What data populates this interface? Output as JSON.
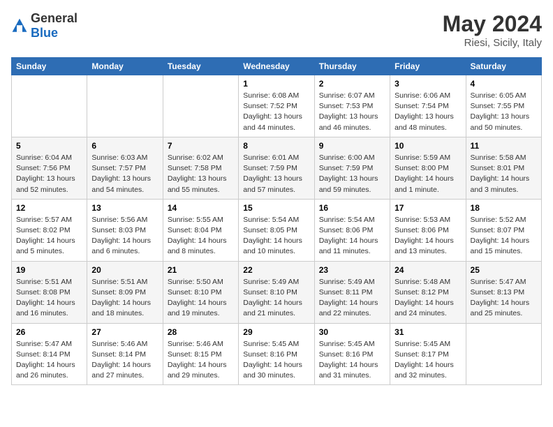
{
  "logo": {
    "text_general": "General",
    "text_blue": "Blue"
  },
  "title": {
    "month_year": "May 2024",
    "location": "Riesi, Sicily, Italy"
  },
  "weekdays": [
    "Sunday",
    "Monday",
    "Tuesday",
    "Wednesday",
    "Thursday",
    "Friday",
    "Saturday"
  ],
  "weeks": [
    [
      {
        "day": "",
        "sunrise": "",
        "sunset": "",
        "daylight": ""
      },
      {
        "day": "",
        "sunrise": "",
        "sunset": "",
        "daylight": ""
      },
      {
        "day": "",
        "sunrise": "",
        "sunset": "",
        "daylight": ""
      },
      {
        "day": "1",
        "sunrise": "Sunrise: 6:08 AM",
        "sunset": "Sunset: 7:52 PM",
        "daylight": "Daylight: 13 hours and 44 minutes."
      },
      {
        "day": "2",
        "sunrise": "Sunrise: 6:07 AM",
        "sunset": "Sunset: 7:53 PM",
        "daylight": "Daylight: 13 hours and 46 minutes."
      },
      {
        "day": "3",
        "sunrise": "Sunrise: 6:06 AM",
        "sunset": "Sunset: 7:54 PM",
        "daylight": "Daylight: 13 hours and 48 minutes."
      },
      {
        "day": "4",
        "sunrise": "Sunrise: 6:05 AM",
        "sunset": "Sunset: 7:55 PM",
        "daylight": "Daylight: 13 hours and 50 minutes."
      }
    ],
    [
      {
        "day": "5",
        "sunrise": "Sunrise: 6:04 AM",
        "sunset": "Sunset: 7:56 PM",
        "daylight": "Daylight: 13 hours and 52 minutes."
      },
      {
        "day": "6",
        "sunrise": "Sunrise: 6:03 AM",
        "sunset": "Sunset: 7:57 PM",
        "daylight": "Daylight: 13 hours and 54 minutes."
      },
      {
        "day": "7",
        "sunrise": "Sunrise: 6:02 AM",
        "sunset": "Sunset: 7:58 PM",
        "daylight": "Daylight: 13 hours and 55 minutes."
      },
      {
        "day": "8",
        "sunrise": "Sunrise: 6:01 AM",
        "sunset": "Sunset: 7:59 PM",
        "daylight": "Daylight: 13 hours and 57 minutes."
      },
      {
        "day": "9",
        "sunrise": "Sunrise: 6:00 AM",
        "sunset": "Sunset: 7:59 PM",
        "daylight": "Daylight: 13 hours and 59 minutes."
      },
      {
        "day": "10",
        "sunrise": "Sunrise: 5:59 AM",
        "sunset": "Sunset: 8:00 PM",
        "daylight": "Daylight: 14 hours and 1 minute."
      },
      {
        "day": "11",
        "sunrise": "Sunrise: 5:58 AM",
        "sunset": "Sunset: 8:01 PM",
        "daylight": "Daylight: 14 hours and 3 minutes."
      }
    ],
    [
      {
        "day": "12",
        "sunrise": "Sunrise: 5:57 AM",
        "sunset": "Sunset: 8:02 PM",
        "daylight": "Daylight: 14 hours and 5 minutes."
      },
      {
        "day": "13",
        "sunrise": "Sunrise: 5:56 AM",
        "sunset": "Sunset: 8:03 PM",
        "daylight": "Daylight: 14 hours and 6 minutes."
      },
      {
        "day": "14",
        "sunrise": "Sunrise: 5:55 AM",
        "sunset": "Sunset: 8:04 PM",
        "daylight": "Daylight: 14 hours and 8 minutes."
      },
      {
        "day": "15",
        "sunrise": "Sunrise: 5:54 AM",
        "sunset": "Sunset: 8:05 PM",
        "daylight": "Daylight: 14 hours and 10 minutes."
      },
      {
        "day": "16",
        "sunrise": "Sunrise: 5:54 AM",
        "sunset": "Sunset: 8:06 PM",
        "daylight": "Daylight: 14 hours and 11 minutes."
      },
      {
        "day": "17",
        "sunrise": "Sunrise: 5:53 AM",
        "sunset": "Sunset: 8:06 PM",
        "daylight": "Daylight: 14 hours and 13 minutes."
      },
      {
        "day": "18",
        "sunrise": "Sunrise: 5:52 AM",
        "sunset": "Sunset: 8:07 PM",
        "daylight": "Daylight: 14 hours and 15 minutes."
      }
    ],
    [
      {
        "day": "19",
        "sunrise": "Sunrise: 5:51 AM",
        "sunset": "Sunset: 8:08 PM",
        "daylight": "Daylight: 14 hours and 16 minutes."
      },
      {
        "day": "20",
        "sunrise": "Sunrise: 5:51 AM",
        "sunset": "Sunset: 8:09 PM",
        "daylight": "Daylight: 14 hours and 18 minutes."
      },
      {
        "day": "21",
        "sunrise": "Sunrise: 5:50 AM",
        "sunset": "Sunset: 8:10 PM",
        "daylight": "Daylight: 14 hours and 19 minutes."
      },
      {
        "day": "22",
        "sunrise": "Sunrise: 5:49 AM",
        "sunset": "Sunset: 8:10 PM",
        "daylight": "Daylight: 14 hours and 21 minutes."
      },
      {
        "day": "23",
        "sunrise": "Sunrise: 5:49 AM",
        "sunset": "Sunset: 8:11 PM",
        "daylight": "Daylight: 14 hours and 22 minutes."
      },
      {
        "day": "24",
        "sunrise": "Sunrise: 5:48 AM",
        "sunset": "Sunset: 8:12 PM",
        "daylight": "Daylight: 14 hours and 24 minutes."
      },
      {
        "day": "25",
        "sunrise": "Sunrise: 5:47 AM",
        "sunset": "Sunset: 8:13 PM",
        "daylight": "Daylight: 14 hours and 25 minutes."
      }
    ],
    [
      {
        "day": "26",
        "sunrise": "Sunrise: 5:47 AM",
        "sunset": "Sunset: 8:14 PM",
        "daylight": "Daylight: 14 hours and 26 minutes."
      },
      {
        "day": "27",
        "sunrise": "Sunrise: 5:46 AM",
        "sunset": "Sunset: 8:14 PM",
        "daylight": "Daylight: 14 hours and 27 minutes."
      },
      {
        "day": "28",
        "sunrise": "Sunrise: 5:46 AM",
        "sunset": "Sunset: 8:15 PM",
        "daylight": "Daylight: 14 hours and 29 minutes."
      },
      {
        "day": "29",
        "sunrise": "Sunrise: 5:45 AM",
        "sunset": "Sunset: 8:16 PM",
        "daylight": "Daylight: 14 hours and 30 minutes."
      },
      {
        "day": "30",
        "sunrise": "Sunrise: 5:45 AM",
        "sunset": "Sunset: 8:16 PM",
        "daylight": "Daylight: 14 hours and 31 minutes."
      },
      {
        "day": "31",
        "sunrise": "Sunrise: 5:45 AM",
        "sunset": "Sunset: 8:17 PM",
        "daylight": "Daylight: 14 hours and 32 minutes."
      },
      {
        "day": "",
        "sunrise": "",
        "sunset": "",
        "daylight": ""
      }
    ]
  ]
}
